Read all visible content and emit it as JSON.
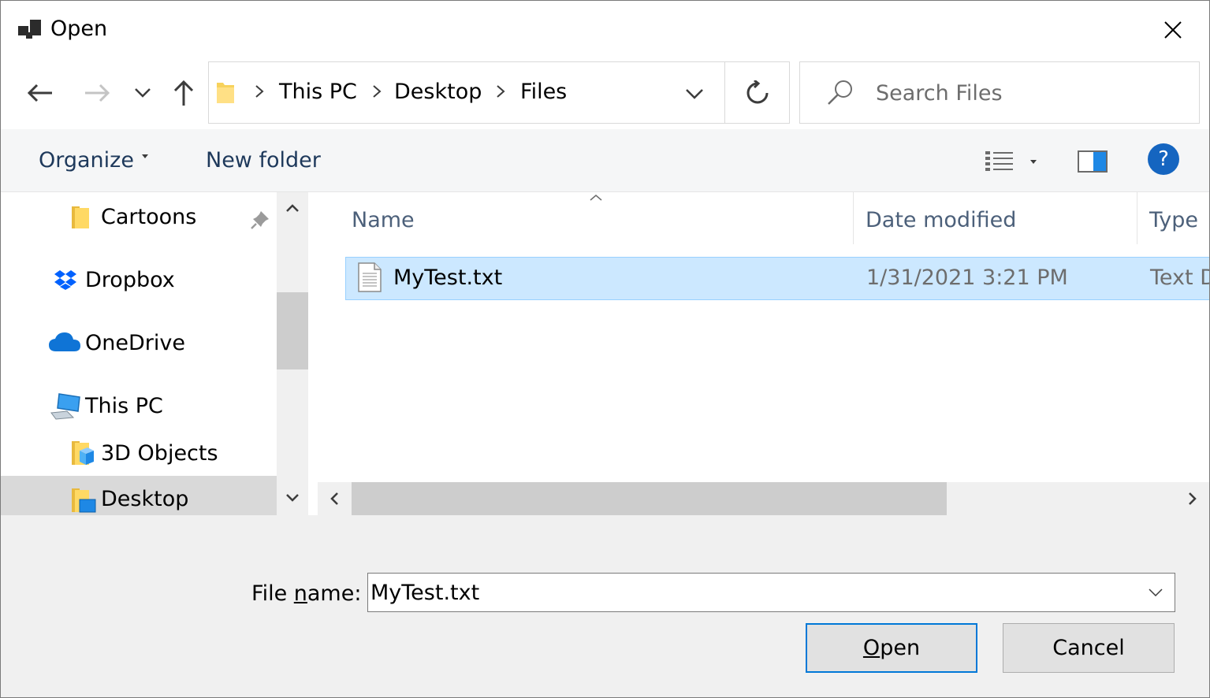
{
  "window": {
    "title": "Open",
    "close_icon": "close-icon"
  },
  "nav": {
    "back_icon": "arrow-left-icon",
    "forward_icon": "arrow-right-icon",
    "recent_icon": "chevron-down-icon",
    "up_icon": "arrow-up-icon",
    "breadcrumb": [
      "This PC",
      "Desktop",
      "Files"
    ],
    "refresh_icon": "refresh-icon"
  },
  "search": {
    "placeholder": "Search Files"
  },
  "toolbar": {
    "organize": "Organize",
    "new_folder": "New folder",
    "help": "?"
  },
  "sidebar": {
    "items": [
      {
        "label": "Cartoons",
        "icon": "folder-icon",
        "pinned": true
      },
      {
        "label": "Dropbox",
        "icon": "dropbox-icon"
      },
      {
        "label": "OneDrive",
        "icon": "cloud-icon"
      },
      {
        "label": "This PC",
        "icon": "computer-icon"
      },
      {
        "label": "3D Objects",
        "icon": "3d-objects-folder-icon"
      },
      {
        "label": "Desktop",
        "icon": "desktop-folder-icon",
        "selected": true
      }
    ]
  },
  "filelist": {
    "columns": [
      "Name",
      "Date modified",
      "Type"
    ],
    "rows": [
      {
        "name": "MyTest.txt",
        "date": "1/31/2021 3:21 PM",
        "type": "Text D",
        "selected": true
      }
    ]
  },
  "footer": {
    "filename_label_pre": "File ",
    "filename_label_ul": "n",
    "filename_label_post": "ame:",
    "filename_value": "MyTest.txt",
    "open_ul": "O",
    "open_rest": "pen",
    "cancel": "Cancel"
  },
  "colors": {
    "selection_bg": "#cce8ff",
    "selection_border": "#99d1ff",
    "accent": "#0078d7",
    "help_blue": "#1565c0"
  }
}
